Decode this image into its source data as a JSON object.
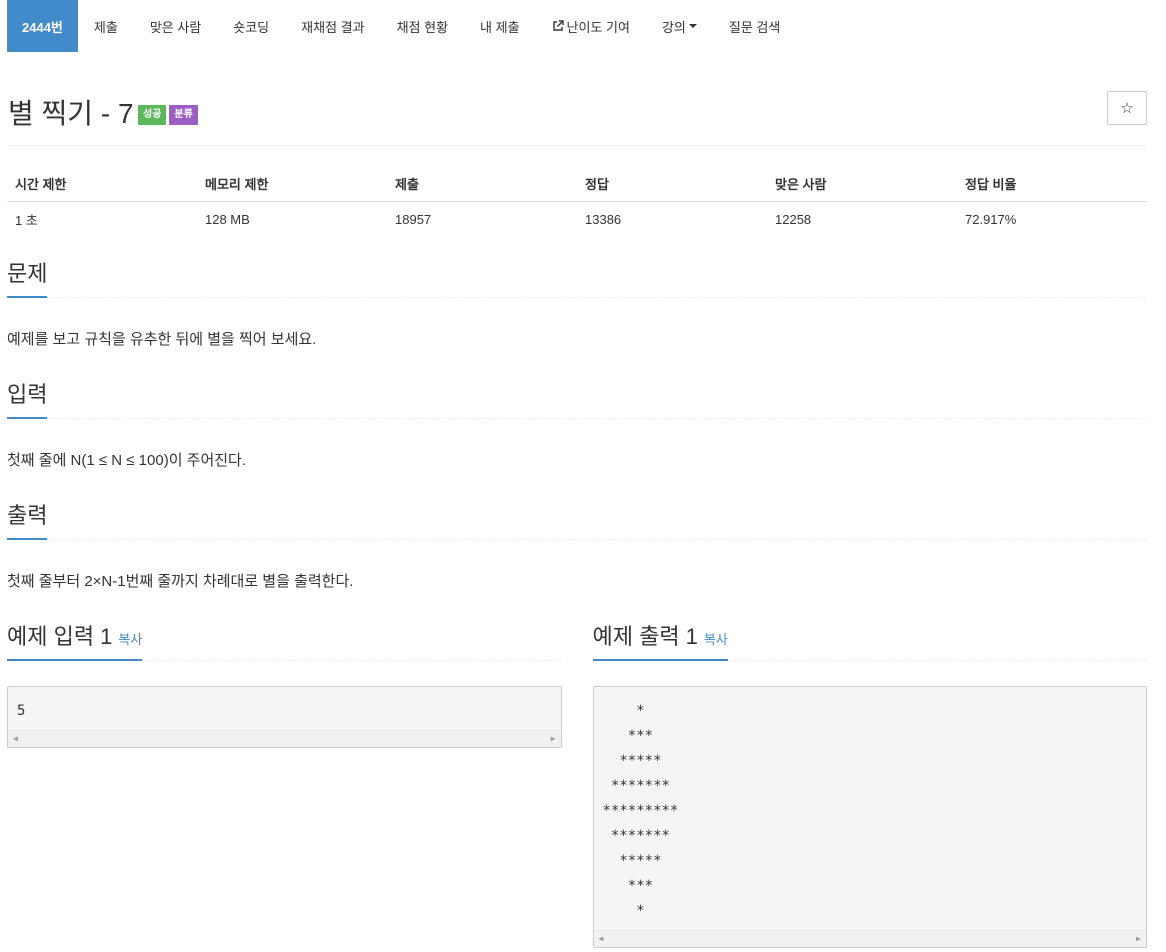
{
  "nav": {
    "tabs": [
      {
        "label": "2444번",
        "active": true
      },
      {
        "label": "제출"
      },
      {
        "label": "맞은 사람"
      },
      {
        "label": "숏코딩"
      },
      {
        "label": "재채점 결과"
      },
      {
        "label": "채점 현황"
      },
      {
        "label": "내 제출"
      },
      {
        "label": "난이도 기여",
        "icon": "external-link-icon"
      },
      {
        "label": "강의",
        "icon": "caret-down-icon"
      },
      {
        "label": "질문 검색"
      }
    ]
  },
  "problem": {
    "title": "별 찍기 - 7",
    "badges": [
      "성공",
      "분류"
    ],
    "star_icon": "☆"
  },
  "info": {
    "headers": [
      "시간 제한",
      "메모리 제한",
      "제출",
      "정답",
      "맞은 사람",
      "정답 비율"
    ],
    "values": [
      "1 초",
      "128 MB",
      "18957",
      "13386",
      "12258",
      "72.917%"
    ]
  },
  "sections": {
    "problem": {
      "title": "문제",
      "text": "예제를 보고 규칙을 유추한 뒤에 별을 찍어 보세요."
    },
    "input": {
      "title": "입력",
      "text": "첫째 줄에 N(1 ≤ N ≤ 100)이 주어진다."
    },
    "output": {
      "title": "출력",
      "text": "첫째 줄부터 2×N-1번째 줄까지 차례대로 별을 출력한다."
    }
  },
  "samples": {
    "input": {
      "title": "예제 입력 1",
      "copy": "복사",
      "content": "5"
    },
    "output": {
      "title": "예제 출력 1",
      "copy": "복사",
      "content": "    *\n   ***\n  *****\n *******\n*********\n *******\n  *****\n   ***\n    *"
    }
  },
  "colors": {
    "accent": "#428bca",
    "success": "#5cb85c",
    "category": "#9c5ec5"
  }
}
